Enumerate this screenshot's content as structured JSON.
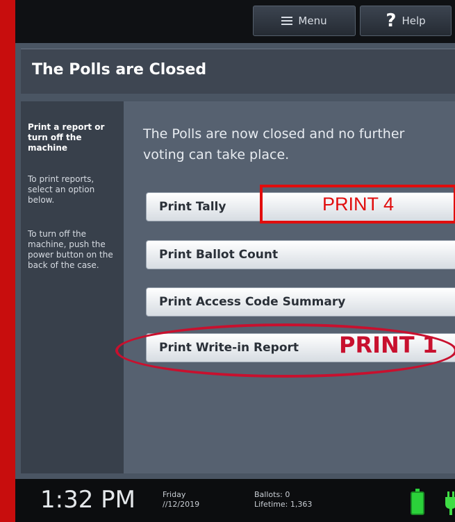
{
  "topbar": {
    "menu_label": "Menu",
    "help_label": "Help"
  },
  "title": "The Polls are Closed",
  "sidebar": {
    "heading": "Print a report or turn off the machine",
    "print_text": "To print reports, select an option below.",
    "power_text": "To turn off the machine, push the power button on the back of the case."
  },
  "main": {
    "message": "The Polls are now closed and no further voting can take place.",
    "buttons": [
      {
        "label": "Print Tally"
      },
      {
        "label": "Print Ballot Count"
      },
      {
        "label": "Print Access Code Summary"
      },
      {
        "label": "Print Write-in Report"
      }
    ]
  },
  "annotations": {
    "print4": "PRINT 4",
    "print1": "PRINT 1"
  },
  "status": {
    "time": "1:32 PM",
    "day": "Friday",
    "date": "//12/2019",
    "ballots_label": "Ballots:",
    "ballots_value": "0",
    "lifetime_label": "Lifetime:",
    "lifetime_value": "1,363"
  },
  "colors": {
    "frame": "#c80d0d",
    "annotation_red": "#e10d0d",
    "battery_green": "#2bd23a"
  },
  "icons": [
    "menu-icon",
    "help-icon",
    "battery-icon",
    "power-plug-icon"
  ]
}
